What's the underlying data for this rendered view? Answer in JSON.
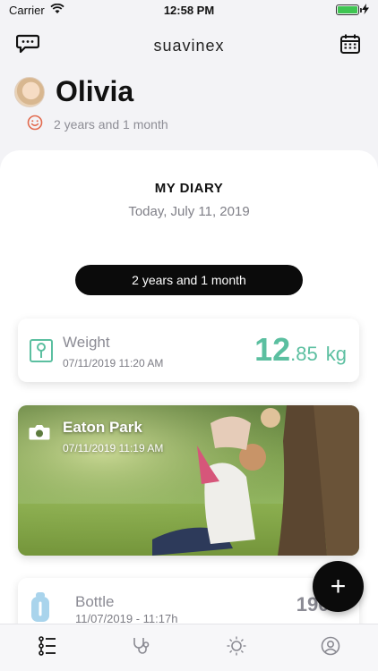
{
  "status_bar": {
    "carrier": "Carrier",
    "time": "12:58 PM"
  },
  "header": {
    "brand": "suavinex",
    "chat_icon": "chat-bubble-icon",
    "calendar_icon": "calendar-icon"
  },
  "profile": {
    "name": "Olivia",
    "age": "2 years and 1 month"
  },
  "diary": {
    "title": "MY DIARY",
    "date": "Today, July 11, 2019",
    "age_pill": "2 years and 1 month"
  },
  "entries": {
    "weight": {
      "label": "Weight",
      "datetime": "07/11/2019 11:20 AM",
      "value_int": "12",
      "value_dec": ".85",
      "unit": "kg"
    },
    "photo": {
      "title": "Eaton Park",
      "datetime": "07/11/2019 11:19 AM"
    },
    "bottle": {
      "label": "Bottle",
      "datetime": "11/07/2019 - 11:17h",
      "value": "190m"
    }
  },
  "fab": {
    "label": "+"
  },
  "tabs": [
    {
      "icon": "list-icon",
      "active": true
    },
    {
      "icon": "stethoscope-icon",
      "active": false
    },
    {
      "icon": "sun-icon",
      "active": false
    },
    {
      "icon": "profile-icon",
      "active": false
    }
  ],
  "colors": {
    "accent_weight": "#5bbfa0",
    "fab": "#0b0b0b",
    "pill": "#0b0b0b",
    "battery": "#3fc552"
  }
}
